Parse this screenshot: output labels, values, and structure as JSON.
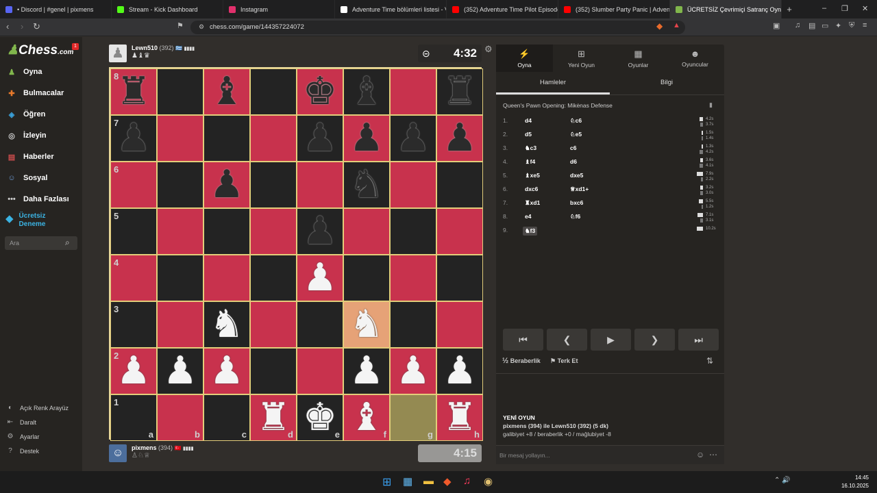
{
  "browser": {
    "tabs": [
      {
        "title": "• Discord | #genel | pixmens",
        "color": "#5865f2"
      },
      {
        "title": "Stream - Kick Dashboard",
        "color": "#53fc18"
      },
      {
        "title": "Instagram",
        "color": "#e1306c"
      },
      {
        "title": "Adventure Time bölümleri listesi - Vi",
        "color": "#ffffff"
      },
      {
        "title": "(352) Adventure Time Pilot Episode (",
        "color": "#ff0000"
      },
      {
        "title": "(352) Slumber Party Panic | Adventur",
        "color": "#ff0000"
      },
      {
        "title": "ÜCRETSİZ Çevrimiçi Satranç Oyn",
        "color": "#81b64c"
      }
    ],
    "new_tab": "+",
    "url": "chess.com/game/144357224072",
    "window_controls": [
      "–",
      "❐",
      "✕"
    ]
  },
  "sidebar": {
    "logo": "Chess",
    "logo_suffix": ".com",
    "badge": "1",
    "items": [
      {
        "label": "Oyna",
        "icon": "pawn-icon",
        "color": "#81b64c"
      },
      {
        "label": "Bulmacalar",
        "icon": "puzzle-icon",
        "color": "#e87a2b"
      },
      {
        "label": "Öğren",
        "icon": "learn-icon",
        "color": "#3aa0d8"
      },
      {
        "label": "İzleyin",
        "icon": "binoculars-icon",
        "color": "#cccccc"
      },
      {
        "label": "Haberler",
        "icon": "news-icon",
        "color": "#c94b4b"
      },
      {
        "label": "Sosyal",
        "icon": "social-icon",
        "color": "#6c9ad2"
      },
      {
        "label": "Daha Fazlası",
        "icon": "more-icon",
        "color": "#cccccc"
      }
    ],
    "premium_line1": "Ücretsiz",
    "premium_line2": "Deneme",
    "search_placeholder": "Ara",
    "footer": [
      "Açık Renk Arayüz",
      "Daralt",
      "Ayarlar",
      "Destek"
    ]
  },
  "top_player": {
    "name": "Lewn510",
    "rating": "(392)",
    "flag": "🇬🇷",
    "bars": "▮▮▮▮",
    "captured": "♟♝♛",
    "clock": "4:32"
  },
  "bottom_player": {
    "name": "pixmens",
    "rating": "(394)",
    "flag": "🇹🇷",
    "bars": "▮▮▮▮",
    "captured": "♙♘♕",
    "clock": "4:15"
  },
  "board": {
    "ranks": [
      "8",
      "7",
      "6",
      "5",
      "4",
      "3",
      "2",
      "1"
    ],
    "files": [
      "a",
      "b",
      "c",
      "d",
      "e",
      "f",
      "g",
      "h"
    ],
    "position": [
      [
        "bR",
        "",
        "bB",
        "",
        "bK",
        "bB",
        "",
        "bR"
      ],
      [
        "bP",
        "",
        "",
        "",
        "bP",
        "bP",
        "bP",
        "bP"
      ],
      [
        "",
        "",
        "bP",
        "",
        "",
        "bN",
        "",
        ""
      ],
      [
        "",
        "",
        "",
        "",
        "bP",
        "",
        "",
        ""
      ],
      [
        "",
        "",
        "",
        "",
        "wP",
        "",
        "",
        ""
      ],
      [
        "",
        "",
        "wN",
        "",
        "",
        "wN",
        "",
        ""
      ],
      [
        "wP",
        "wP",
        "wP",
        "",
        "",
        "wP",
        "wP",
        "wP"
      ],
      [
        "",
        "",
        "",
        "wR",
        "wK",
        "wB",
        "",
        "wR"
      ]
    ],
    "highlight_last_from": "g1",
    "highlight_last_to": "f3",
    "light_color": "#c8324d",
    "dark_color": "#232323"
  },
  "panel": {
    "top_tabs": [
      {
        "label": "Oyna",
        "icon": "bolt-icon"
      },
      {
        "label": "Yeni Oyun",
        "icon": "plus-icon"
      },
      {
        "label": "Oyunlar",
        "icon": "board-icon"
      },
      {
        "label": "Oyuncular",
        "icon": "players-icon"
      }
    ],
    "sub_tabs": [
      "Hamleler",
      "Bilgi"
    ],
    "opening": "Queen's Pawn Opening: Mikėnas Defense",
    "moves": [
      {
        "num": "1.",
        "white": "d4",
        "black": "♘c6",
        "wt": "4.2s",
        "bt": "3.7s",
        "wbar": 0.55,
        "bbar": 0.5
      },
      {
        "num": "2.",
        "white": "d5",
        "black": "♘e5",
        "wt": "1.5s",
        "bt": "1.4s",
        "wbar": 0.2,
        "bbar": 0.2
      },
      {
        "num": "3.",
        "white": "♞c3",
        "black": "c6",
        "wt": "1.3s",
        "bt": "4.2s",
        "wbar": 0.18,
        "bbar": 0.55
      },
      {
        "num": "4.",
        "white": "♝f4",
        "black": "d6",
        "wt": "3.6s",
        "bt": "4.1s",
        "wbar": 0.48,
        "bbar": 0.54
      },
      {
        "num": "5.",
        "white": "♝xe5",
        "black": "dxe5",
        "wt": "7.9s",
        "bt": "2.2s",
        "wbar": 1.0,
        "bbar": 0.3
      },
      {
        "num": "6.",
        "white": "dxc6",
        "black": "♕xd1+",
        "wt": "3.2s",
        "bt": "3.0s",
        "wbar": 0.42,
        "bbar": 0.4
      },
      {
        "num": "7.",
        "white": "♜xd1",
        "black": "bxc6",
        "wt": "5.5s",
        "bt": "1.2s",
        "wbar": 0.7,
        "bbar": 0.16
      },
      {
        "num": "8.",
        "white": "e4",
        "black": "♘f6",
        "wt": "7.1s",
        "bt": "3.1s",
        "wbar": 0.9,
        "bbar": 0.4
      },
      {
        "num": "9.",
        "white": "♞f3",
        "black": "",
        "wt": "10.2s",
        "bt": "",
        "wbar": 1.0,
        "bbar": 0
      }
    ],
    "controls": [
      "⏮",
      "❮",
      "▶",
      "❯",
      "⏭"
    ],
    "draw_label": "Beraberlik",
    "draw_icon": "½",
    "resign_label": "Terk Et",
    "new_game_title": "YENİ OYUN",
    "new_game_line": "pixmens (394) ile Lewn510 (392) (5 dk)",
    "record_line": "galibiyet +8 / beraberlik +0 / mağlubiyet -8",
    "chat_placeholder": "Bir mesaj yollayın..."
  },
  "taskbar": {
    "time": "14:45",
    "date": "16.10.2025"
  }
}
